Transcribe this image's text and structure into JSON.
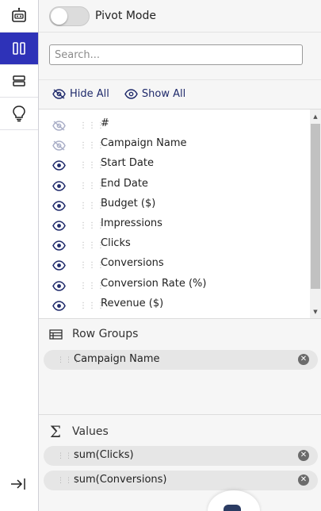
{
  "rail": {
    "items": [
      {
        "name": "robot-icon",
        "active": false
      },
      {
        "name": "columns-icon",
        "active": true
      },
      {
        "name": "rows-icon",
        "active": false
      },
      {
        "name": "lightbulb-icon",
        "active": false
      }
    ],
    "collapse_icon": "collapse-right-icon"
  },
  "pivot": {
    "label": "Pivot Mode",
    "enabled": false
  },
  "search": {
    "placeholder": "Search...",
    "value": ""
  },
  "visibility": {
    "hide_all": "Hide All",
    "show_all": "Show All"
  },
  "columns": [
    {
      "label": "#",
      "visible": false
    },
    {
      "label": "Campaign Name",
      "visible": false
    },
    {
      "label": "Start Date",
      "visible": true
    },
    {
      "label": "End Date",
      "visible": true
    },
    {
      "label": "Budget ($)",
      "visible": true
    },
    {
      "label": "Impressions",
      "visible": true
    },
    {
      "label": "Clicks",
      "visible": true
    },
    {
      "label": "Conversions",
      "visible": true
    },
    {
      "label": "Conversion Rate (%)",
      "visible": true
    },
    {
      "label": "Revenue ($)",
      "visible": true
    }
  ],
  "row_groups": {
    "title": "Row Groups",
    "items": [
      {
        "label": "Campaign Name"
      }
    ]
  },
  "values": {
    "title": "Values",
    "items": [
      {
        "label": "sum(Clicks)"
      },
      {
        "label": "sum(Conversions)"
      }
    ]
  },
  "colors": {
    "accent": "#2e32b8",
    "icon_dark": "#1f2a6b",
    "icon_faded": "#a9aec7"
  }
}
